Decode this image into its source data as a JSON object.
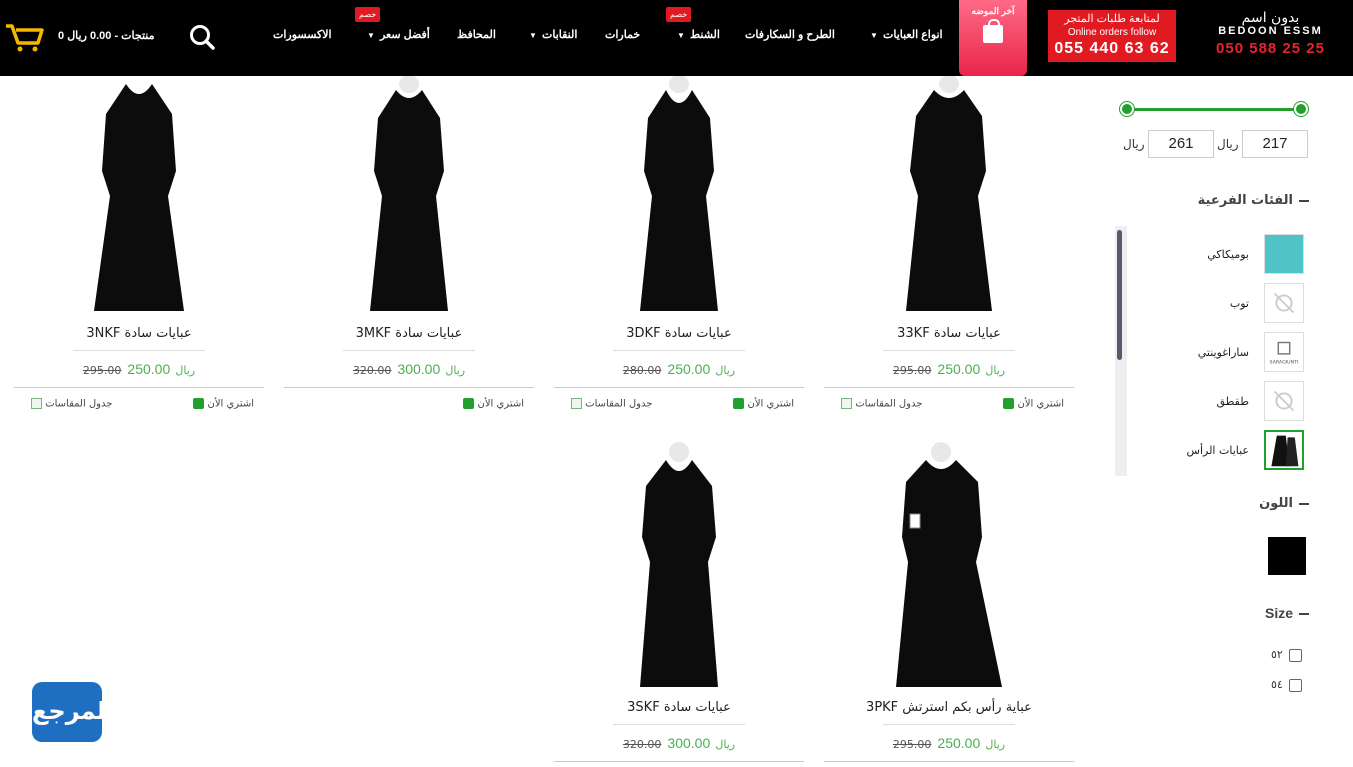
{
  "header": {
    "logo": {
      "ar": "بدون اسم",
      "en": "BEDOON ESSM",
      "phone": "050 588 25 25"
    },
    "orders": {
      "line1": "لمتابعة طلبات المتجر",
      "line2": "Online orders follow",
      "phone": "055 440 63 62"
    },
    "latest_label": "آخر الموضه",
    "nav": {
      "abayas": "انواع العبايات",
      "scarves": "الطرح و السكارفات",
      "bags": "الشنط",
      "khimars": "خمارات",
      "niqabs": "النقابات",
      "wallets": "المحافظ",
      "best_price": "أفضل سعر",
      "accessories": "الاكسسورات"
    },
    "badge": "خصم",
    "cart": "0 منتجات - 0.00 ريال"
  },
  "sidebar": {
    "price_min": "217",
    "price_max": "261",
    "currency": "ريال",
    "subcats_title": "الفئات الفرعية",
    "subcats": [
      "بوميكاكي",
      "توب",
      "ساراغوينتي",
      "طقطق",
      "عبايات الرأس"
    ],
    "color_title": "اللون",
    "size_title": "Size",
    "sizes": [
      "٥٢",
      "٥٤"
    ]
  },
  "products": [
    {
      "name": "33KF عبايات سادة",
      "price": "250.00",
      "old": "295.00",
      "currency": "ريال",
      "buy": "اشتري الأن",
      "size_chart": "جدول المقاسات"
    },
    {
      "name": "3DKF عبايات سادة",
      "price": "250.00",
      "old": "280.00",
      "currency": "ريال",
      "buy": "اشتري الأن",
      "size_chart": "جدول المقاسات"
    },
    {
      "name": "3MKF عبايات سادة",
      "price": "300.00",
      "old": "320.00",
      "currency": "ريال",
      "buy": "اشتري الأن"
    },
    {
      "name": "3NKF عبايات سادة",
      "price": "250.00",
      "old": "295.00",
      "currency": "ريال",
      "buy": "اشتري الأن",
      "size_chart": "جدول المقاسات"
    },
    {
      "name": "3PKF عباية رأس بكم استرتش",
      "price": "250.00",
      "old": "295.00",
      "currency": "ريال"
    },
    {
      "name": "3SKF عبايات سادة",
      "price": "300.00",
      "old": "320.00",
      "currency": "ريال"
    }
  ],
  "corner_logo": "المرجع",
  "colors": {
    "accent_green": "#22a02e",
    "brand_red": "#e11a22",
    "price_green": "#4caf50"
  }
}
